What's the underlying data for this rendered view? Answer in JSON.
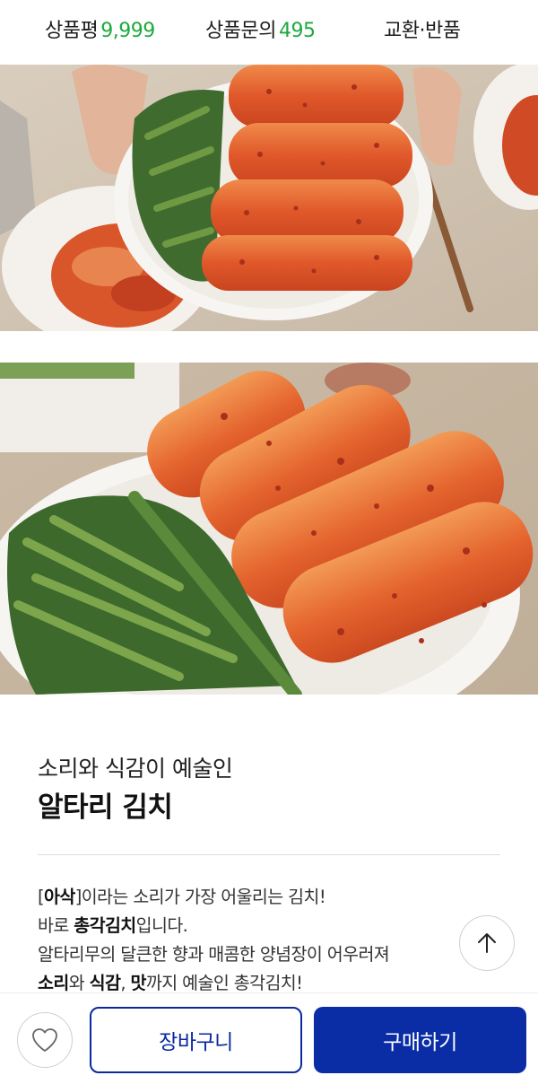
{
  "tabs": {
    "review_label": "상품평",
    "review_count": "9,999",
    "inquiry_label": "상품문의",
    "inquiry_count": "495",
    "return_label": "교환·반품"
  },
  "product": {
    "subtitle": "소리와 식감이 예술인",
    "title": "알타리 김치",
    "description": {
      "line1_bracket_open": "[",
      "line1_emphasis": "아삭",
      "line1_rest": "]이라는 소리가 가장 어울리는 김치!",
      "line2_prefix": "바로 ",
      "line2_emphasis": "총각김치",
      "line2_suffix": "입니다.",
      "line3": "알타리무의 달큰한 향과 매콤한 양념장이 어우러져",
      "line4_emphasis1": "소리",
      "line4_mid1": "와 ",
      "line4_emphasis2": "식감",
      "line4_mid2": ", ",
      "line4_emphasis3": "맛",
      "line4_rest": "까지 예술인 총각김치!"
    }
  },
  "icons": {
    "scroll_top": "arrow-up-icon",
    "wishlist": "heart-icon"
  },
  "actions": {
    "cart_label": "장바구니",
    "buy_label": "구매하기"
  },
  "colors": {
    "accent_green": "#1fa93e",
    "primary_blue": "#0a2da6",
    "cart_border": "#0a2a9e"
  }
}
